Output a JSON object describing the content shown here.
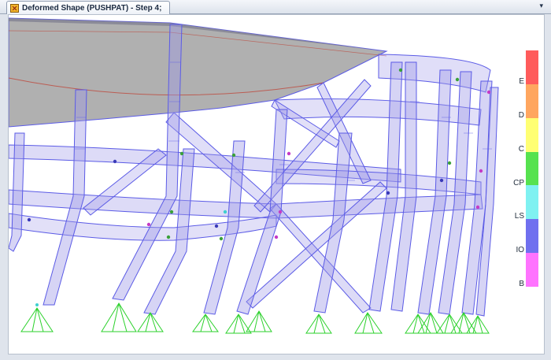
{
  "window": {
    "tab_title": "Deformed Shape (PUSHPAT) - Step 4;",
    "tab_menu_glyph": "▾"
  },
  "legend": {
    "labels": [
      "E",
      "D",
      "C",
      "CP",
      "LS",
      "IO",
      "B"
    ],
    "colors": [
      "#ff5b5b",
      "#ffa65f",
      "#ffff73",
      "#56e24f",
      "#7ff1f1",
      "#7070ef",
      "#ff73ff"
    ]
  },
  "colors": {
    "member_fill": "#9e98e8",
    "member_stroke": "#5b5be6",
    "slab": "#9a9a9a",
    "support": "#2bd12b"
  }
}
